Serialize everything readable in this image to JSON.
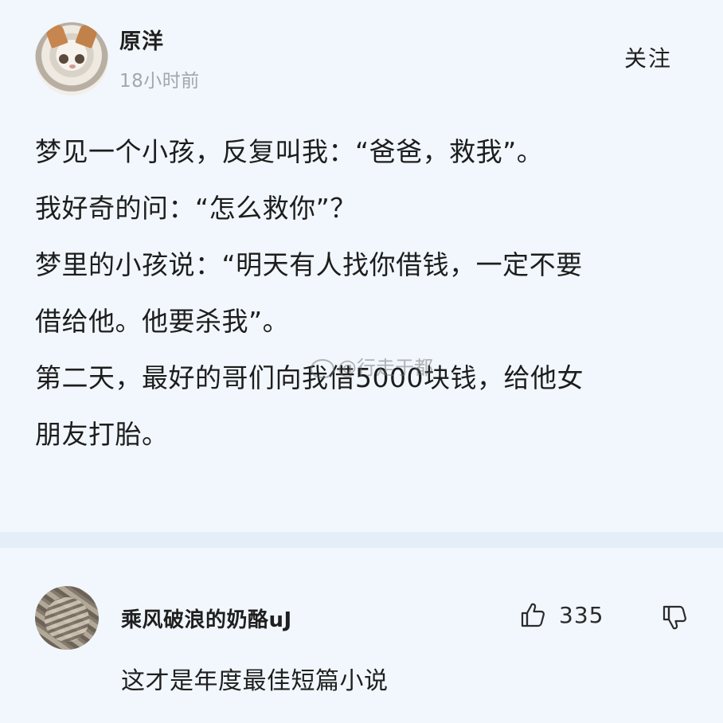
{
  "post": {
    "author": "原洋",
    "time": "18小时前",
    "follow_label": "关注",
    "lines": [
      "梦见一个小孩，反复叫我：“爸爸，救我”。",
      "我好奇的问：“怎么救你”？",
      "梦里的小孩说：“明天有人找你借钱，一定不要",
      "借给他。他要杀我”。",
      "第二天，最好的哥们向我借5000块钱，给他女",
      "朋友打胎。"
    ],
    "watermark": "@行走于都"
  },
  "comment": {
    "author": "乘风破浪的奶酪uJ",
    "likes": "335",
    "text": "这才是年度最佳短篇小说"
  },
  "icons": {
    "like": "thumbs-up-icon",
    "dislike": "thumbs-down-icon"
  }
}
